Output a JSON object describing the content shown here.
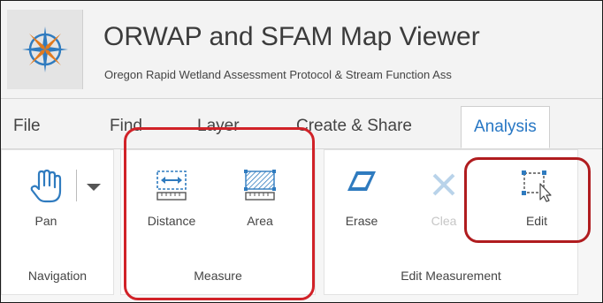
{
  "header": {
    "title": "ORWAP and SFAM Map Viewer",
    "subtitle": "Oregon Rapid Wetland Assessment Protocol & Stream Function Ass",
    "logo_icon": "compass-rose-icon"
  },
  "tabs": [
    {
      "label": "File",
      "active": false
    },
    {
      "label": "Find",
      "active": false
    },
    {
      "label": "Layer",
      "active": false
    },
    {
      "label": "Create & Share",
      "active": false
    },
    {
      "label": "Analysis",
      "active": true
    }
  ],
  "ribbon": {
    "navigation": {
      "group_label": "Navigation",
      "pan_label": "Pan",
      "pan_icon": "hand-icon",
      "dropdown_icon": "caret-down-icon"
    },
    "measure": {
      "group_label": "Measure",
      "distance_label": "Distance",
      "distance_icon": "ruler-distance-icon",
      "area_label": "Area",
      "area_icon": "ruler-area-icon"
    },
    "edit_measurement": {
      "group_label": "Edit Measurement",
      "erase_label": "Erase",
      "erase_icon": "eraser-icon",
      "clear_label": "Clea",
      "clear_icon": "x-icon",
      "edit_label": "Edit",
      "edit_icon": "edit-selection-icon"
    }
  },
  "colors": {
    "accent": "#2777c4",
    "callout_red": "#d12228",
    "header_bg": "#f3f3f3"
  }
}
